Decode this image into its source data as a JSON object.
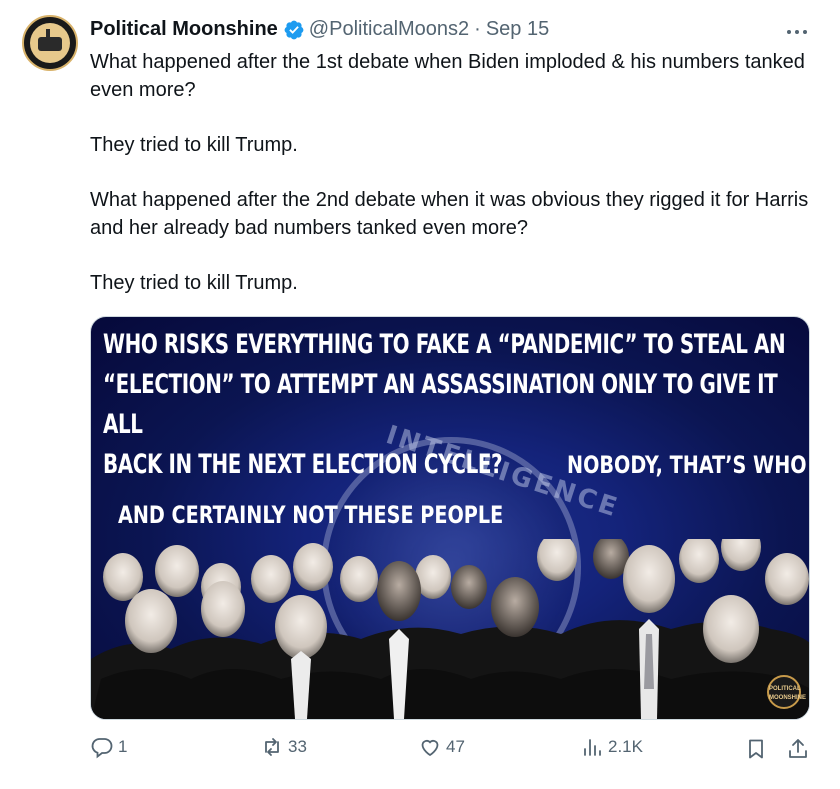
{
  "tweet": {
    "display_name": "Political Moonshine",
    "handle": "@PoliticalMoons2",
    "separator": "·",
    "date": "Sep 15",
    "paragraphs": [
      "What happened after the 1st debate when Biden imploded & his numbers tanked even more?",
      "They tried to kill Trump.",
      "What happened after the 2nd debate when it was obvious they rigged it for Harris and her already bad numbers tanked even more?",
      "They tried to kill Trump."
    ]
  },
  "media": {
    "headline": "WHO RISKS EVERYTHING TO FAKE A “PANDEMIC” TO STEAL AN “ELECTION” TO ATTEMPT AN ASSASSINATION ONLY TO GIVE IT ALL BACK IN THE NEXT ELECTION CYCLE?",
    "headline_lines": [
      "WHO RISKS EVERYTHING TO FAKE A “PANDEMIC” TO STEAL AN",
      "“ELECTION” TO ATTEMPT AN ASSASSINATION ONLY TO GIVE IT ALL",
      "BACK IN THE NEXT ELECTION CYCLE?"
    ],
    "nobody": "NOBODY, THAT’S WHO",
    "certainly": "AND CERTAINLY NOT THESE PEOPLE",
    "seal_text": "INTELLIGENCE",
    "badge": "POLITICAL MOONSHINE"
  },
  "actions": {
    "replies": "1",
    "reposts": "33",
    "likes": "47",
    "views": "2.1K"
  },
  "icons": {
    "verified": "verified-badge-icon",
    "more": "more-icon",
    "reply": "reply-icon",
    "repost": "repost-icon",
    "like": "heart-icon",
    "views": "views-icon",
    "bookmark": "bookmark-icon",
    "share": "share-icon"
  },
  "colors": {
    "text": "#0f1419",
    "secondary": "#536471",
    "verified": "#1d9bf0"
  }
}
